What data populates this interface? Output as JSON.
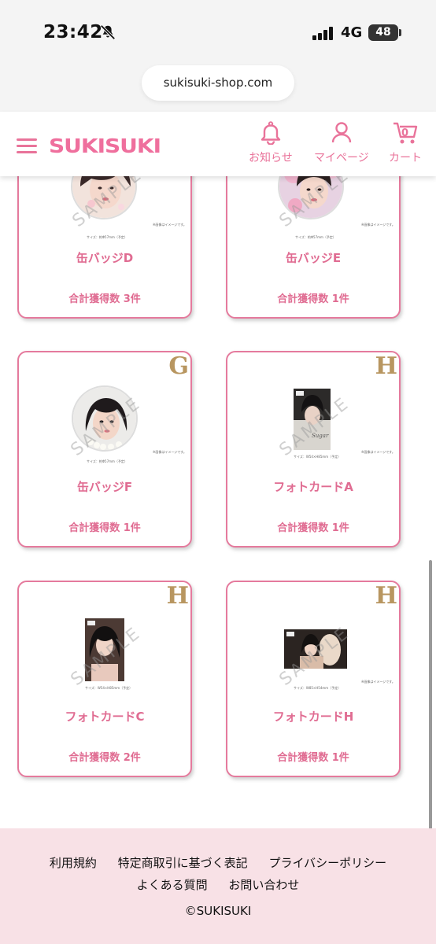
{
  "status_bar": {
    "time": "23:42",
    "network": "4G",
    "battery": "48"
  },
  "browser": {
    "url": "sukisuki-shop.com"
  },
  "header": {
    "logo": "SUKISUKI",
    "nav": [
      {
        "label": "お知らせ",
        "icon": "bell-icon"
      },
      {
        "label": "マイページ",
        "icon": "person-icon"
      },
      {
        "label": "カート",
        "icon": "cart-icon",
        "count": "0"
      }
    ]
  },
  "products": [
    {
      "name": "缶バッジD",
      "count_text": "合計獲得数 3件",
      "letter": "",
      "caption": "サイズ：約Φ57mm（予定）",
      "note": "※画像はイメージです。"
    },
    {
      "name": "缶バッジE",
      "count_text": "合計獲得数 1件",
      "letter": "",
      "caption": "サイズ：約Φ57mm（予定）",
      "note": "※画像はイメージです。"
    },
    {
      "name": "缶バッジF",
      "count_text": "合計獲得数 1件",
      "letter": "G",
      "caption": "サイズ：約Φ57mm（予定）",
      "note": "※画像はイメージです。"
    },
    {
      "name": "フォトカードA",
      "count_text": "合計獲得数 1件",
      "letter": "H",
      "caption": "サイズ：W54×H85mm（予定）",
      "note": "※画像はイメージです。"
    },
    {
      "name": "フォトカードC",
      "count_text": "合計獲得数 2件",
      "letter": "H",
      "caption": "サイズ：W54×H85mm（予定）",
      "note": "※画像はイメージです。"
    },
    {
      "name": "フォトカードH",
      "count_text": "合計獲得数 1件",
      "letter": "H",
      "caption": "サイズ：W85×H54mm（予定）",
      "note": "※画像はイメージです。"
    }
  ],
  "watermark": "SAMPLE",
  "footer": {
    "links_row1": [
      "利用規約",
      "特定商取引に基づく表記",
      "プライバシーポリシー"
    ],
    "links_row2": [
      "よくある質問",
      "お問い合わせ"
    ],
    "copyright": "©SUKISUKI"
  },
  "colors": {
    "accent": "#e9739a",
    "logo": "#ef6f9d",
    "gold_letter": "#b89660",
    "footer_bg": "#f8e1e6"
  }
}
